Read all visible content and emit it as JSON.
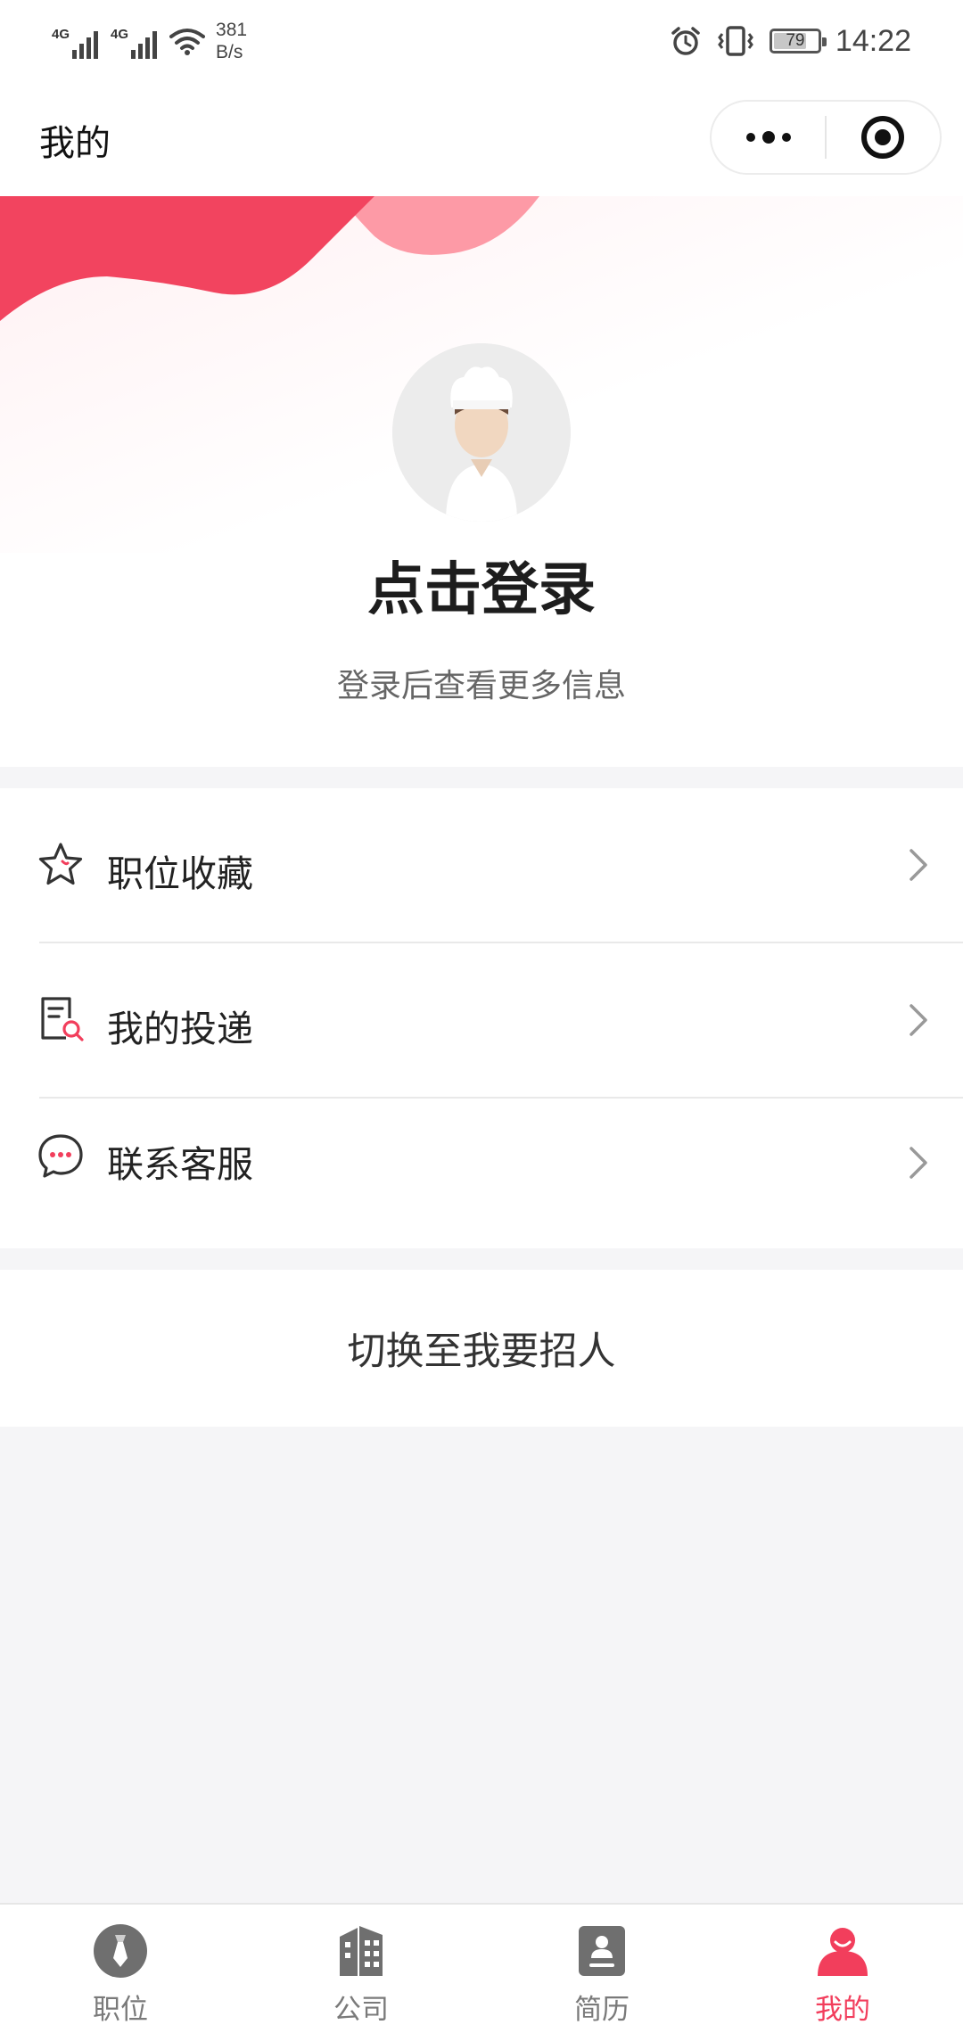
{
  "status_bar": {
    "network1": "4G",
    "network2": "4G",
    "speed_value": "381",
    "speed_unit": "B/s",
    "battery": "79",
    "time": "14:22"
  },
  "nav": {
    "title": "我的"
  },
  "profile": {
    "login_title": "点击登录",
    "login_subtitle": "登录后查看更多信息"
  },
  "menu": {
    "items": [
      {
        "label": "职位收藏",
        "icon": "star-icon"
      },
      {
        "label": "我的投递",
        "icon": "document-search-icon"
      },
      {
        "label": "联系客服",
        "icon": "chat-bubble-icon"
      }
    ]
  },
  "switch_role_label": "切换至我要招人",
  "tabs": [
    {
      "label": "职位",
      "icon": "tie-icon",
      "active": false
    },
    {
      "label": "公司",
      "icon": "building-icon",
      "active": false
    },
    {
      "label": "简历",
      "icon": "resume-icon",
      "active": false
    },
    {
      "label": "我的",
      "icon": "person-icon",
      "active": true
    }
  ],
  "colors": {
    "accent": "#f23e5c",
    "background": "#f5f5f7"
  }
}
